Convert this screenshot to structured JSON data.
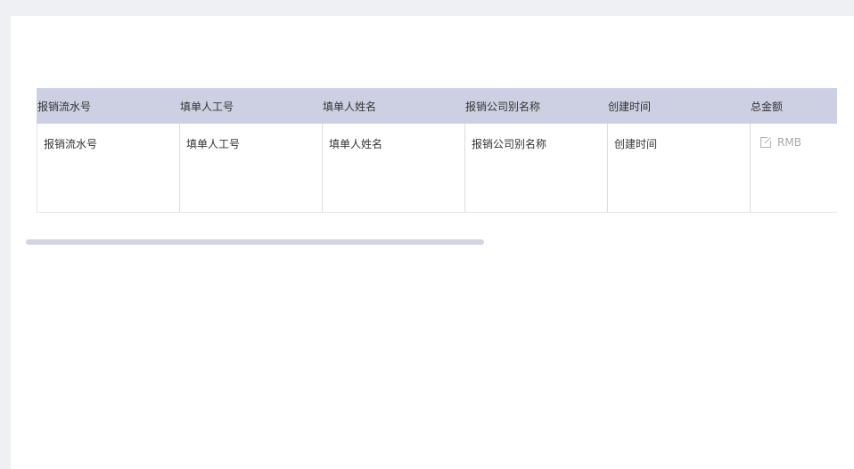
{
  "table": {
    "headers": [
      "报销流水号",
      "填单人工号",
      "填单人姓名",
      "报销公司别名称",
      "创建时间",
      "总金额"
    ],
    "row": {
      "serial_no": "报销流水号",
      "filler_id": "填单人工号",
      "filler_name": "填单人姓名",
      "company_alias": "报销公司别名称",
      "created_time": "创建时间",
      "total_amount_unit": "RMB"
    },
    "icons": {
      "amount_edit": "edit-icon"
    }
  },
  "scrollbar": {
    "thumb_fraction": 0.56
  },
  "colors": {
    "header_bg": "#cdd0e2",
    "scroll_thumb": "#d3d5e1",
    "page_bg": "#eef0f3"
  }
}
